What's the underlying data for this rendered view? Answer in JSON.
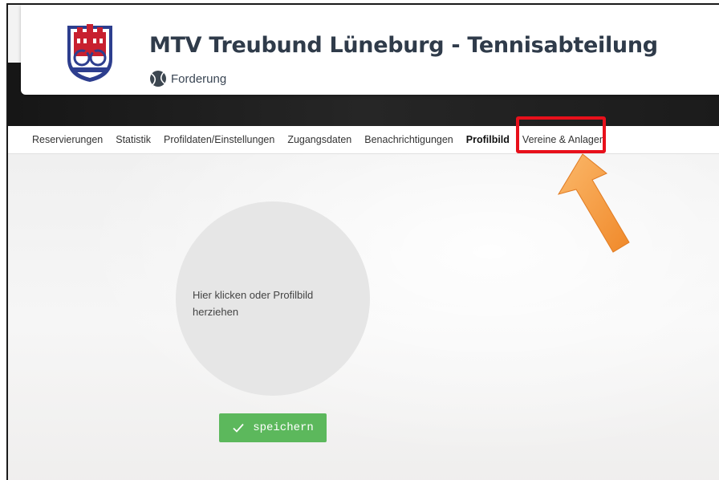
{
  "header": {
    "title": "MTV Treubund Lüneburg - Tennisabteilung",
    "subtitle": "Forderung",
    "logo_icon": "club-crest-icon",
    "subtitle_icon": "tennis-ball-icon"
  },
  "nav": {
    "items": [
      {
        "label": "Reservierungen"
      },
      {
        "label": "Statistik"
      },
      {
        "label": "Profildaten/Einstellungen"
      },
      {
        "label": "Zugangsdaten"
      },
      {
        "label": "Benachrichtigungen"
      },
      {
        "label": "Profilbild",
        "active": true
      },
      {
        "label": "Vereine & Anlagen"
      }
    ]
  },
  "upload": {
    "text": "Hier klicken oder Profilbild herziehen"
  },
  "save_button": {
    "label": "speichern",
    "icon": "check-icon",
    "color": "#5cb85c"
  },
  "annotation": {
    "highlight_color": "#e8101b",
    "arrow_color": "#f59a3c"
  }
}
